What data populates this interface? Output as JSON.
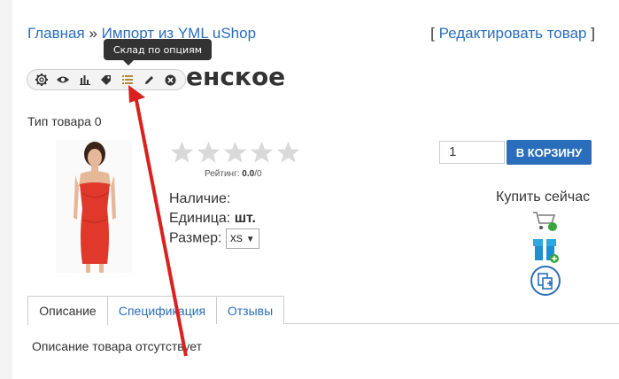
{
  "breadcrumb": {
    "home": "Главная",
    "sep": "»",
    "section": "Импорт из YML uShop"
  },
  "edit": {
    "open": "[",
    "label": "Редактировать товар",
    "close": "]"
  },
  "product": {
    "title_visible": "енское"
  },
  "toolbar": {
    "icons": [
      "gear-icon",
      "eye-icon",
      "bar-chart-icon",
      "tags-icon",
      "list-icon",
      "pencil-icon",
      "close-icon"
    ],
    "tooltip": "Склад по опциям"
  },
  "type_line": "Тип товара 0",
  "rating": {
    "label": "Рейтинг:",
    "value": "0.0",
    "total": "/0",
    "stars": 5
  },
  "availability": {
    "label": "Наличие:"
  },
  "unit": {
    "label": "Единица:",
    "value": "шт."
  },
  "size": {
    "label": "Размер:",
    "selected": "xs"
  },
  "quantity": {
    "value": "1"
  },
  "cart_button": "В КОРЗИНУ",
  "buy_now": "Купить сейчас",
  "tabs": [
    {
      "label": "Описание",
      "active": true
    },
    {
      "label": "Спецификация",
      "active": false
    },
    {
      "label": "Отзывы",
      "active": false
    }
  ],
  "description": "Описание товара отсутствует",
  "colors": {
    "link": "#2a6ebb",
    "button": "#2a6ebb",
    "arrow": "#d9221f",
    "dress": "#e0392b"
  }
}
